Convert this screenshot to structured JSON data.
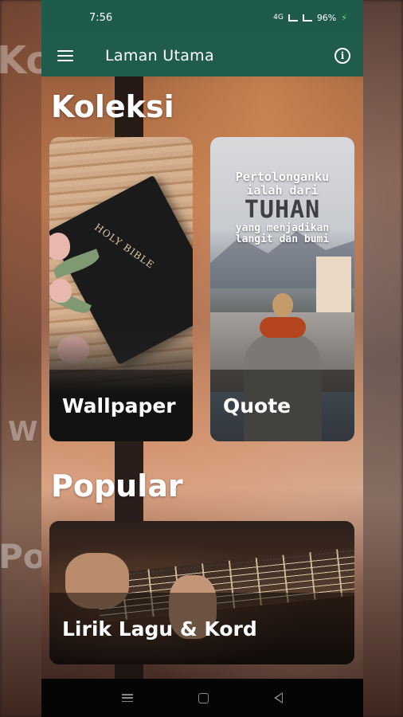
{
  "status": {
    "time": "7:56",
    "network": "4G",
    "battery": "96%"
  },
  "appbar": {
    "title": "Laman Utama",
    "menu_icon": "hamburger-menu-icon",
    "info_icon": "info-icon"
  },
  "sections": {
    "koleksi": "Koleksi",
    "popular": "Popular"
  },
  "cards": {
    "wallpaper": {
      "label": "Wallpaper",
      "image_text": "HOLY BIBLE"
    },
    "quote": {
      "label": "Quote",
      "image_lines": [
        "Pertolonganku",
        "ialah dari",
        "TUHAN",
        "yang menjadikan",
        "langit dan bumi"
      ]
    },
    "lirik": {
      "label": "Lirik Lagu & Kord"
    }
  },
  "colors": {
    "appbar": "#1f5c4c",
    "statusbar": "#1e5b4b",
    "battery_accent": "#7bdc7b"
  },
  "navbar": {
    "recent_icon": "recent-apps-icon",
    "home_icon": "home-icon",
    "back_icon": "back-icon"
  },
  "background_ghost": {
    "left_top": "Ko",
    "left_mid": "W",
    "left_bottom": "Po"
  }
}
